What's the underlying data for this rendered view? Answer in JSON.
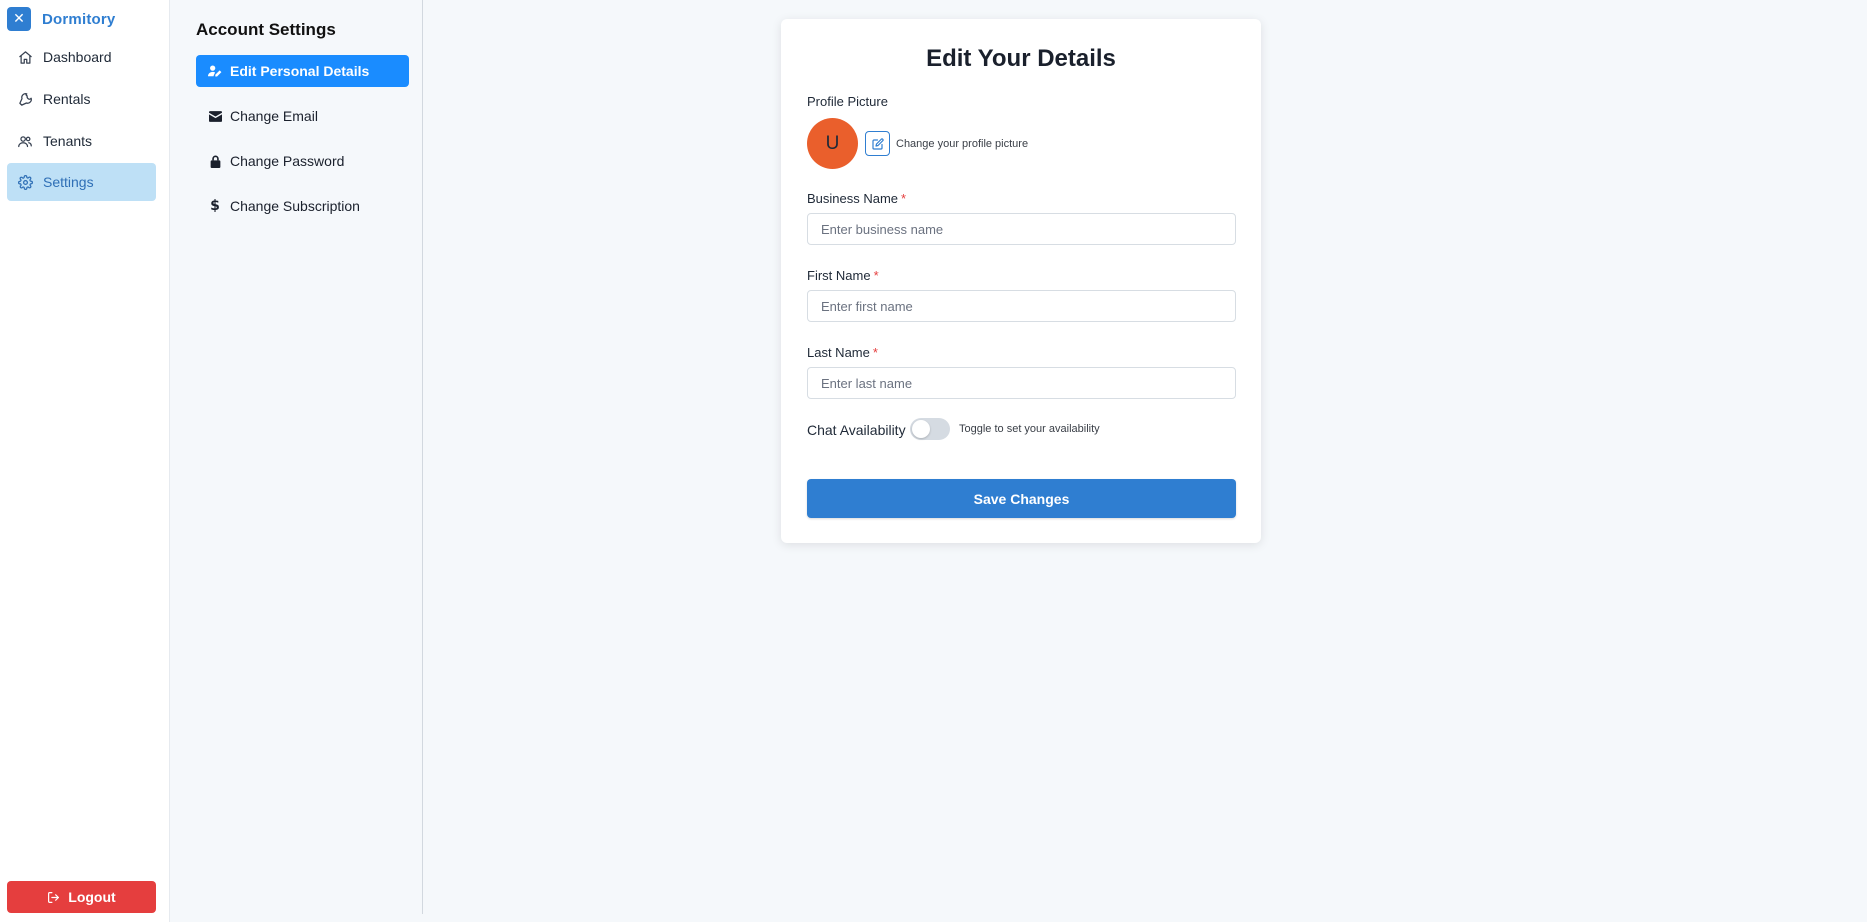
{
  "brand": {
    "toggle_icon": "close-icon",
    "name": "Dormitory",
    "color": "#2f7ed1"
  },
  "sidebar": {
    "items": [
      {
        "label": "Dashboard",
        "icon": "home-icon"
      },
      {
        "label": "Rentals",
        "icon": "wrench-icon"
      },
      {
        "label": "Tenants",
        "icon": "users-icon"
      },
      {
        "label": "Settings",
        "icon": "gear-icon",
        "active": true
      }
    ],
    "logout_label": "Logout",
    "logout_icon": "logout-icon",
    "logout_color": "#e53e3e"
  },
  "settings_nav": {
    "title": "Account Settings",
    "items": [
      {
        "label": "Edit Personal Details",
        "icon": "user-edit-icon",
        "active": true
      },
      {
        "label": "Change Email",
        "icon": "envelope-icon"
      },
      {
        "label": "Change Password",
        "icon": "lock-icon"
      },
      {
        "label": "Change Subscription",
        "icon": "dollar-icon"
      }
    ],
    "active_color": "#1a8cff"
  },
  "form": {
    "title": "Edit Your Details",
    "profile_picture_label": "Profile Picture",
    "avatar_initial": "U",
    "avatar_color": "#ea5f2c",
    "change_picture_hint": "Change your profile picture",
    "required_mark": "*",
    "business_name": {
      "label": "Business Name",
      "placeholder": "Enter business name",
      "value": ""
    },
    "first_name": {
      "label": "First Name",
      "placeholder": "Enter first name",
      "value": ""
    },
    "last_name": {
      "label": "Last Name",
      "placeholder": "Enter last name",
      "value": ""
    },
    "chat_availability": {
      "label": "Chat Availability",
      "hint": "Toggle to set your availability",
      "enabled": false
    },
    "save_label": "Save Changes",
    "save_color": "#2f7ed1"
  }
}
